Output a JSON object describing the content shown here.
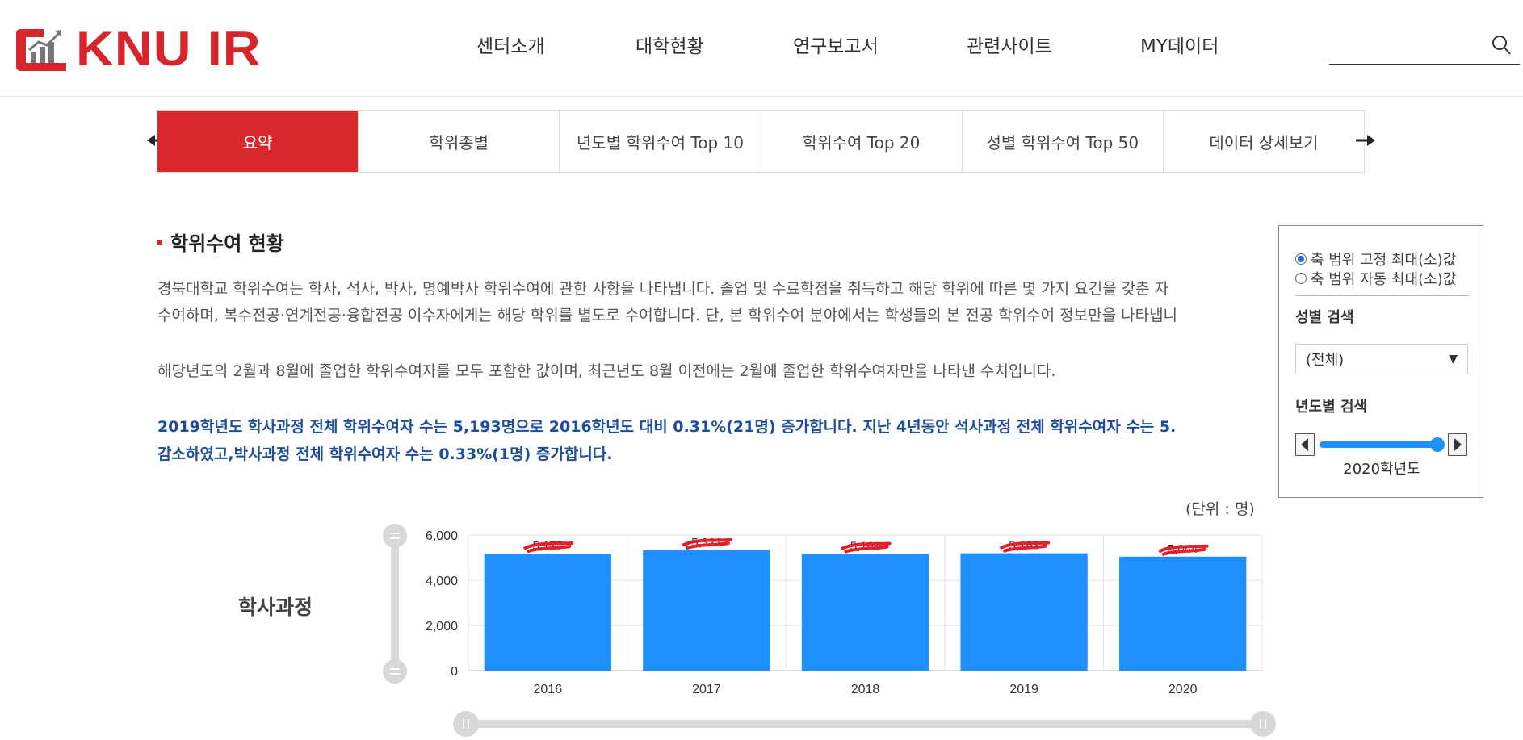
{
  "header": {
    "logo_text": "KNU IR",
    "nav": [
      "센터소개",
      "대학현황",
      "연구보고서",
      "관련사이트",
      "MY데이터"
    ],
    "search_placeholder": ""
  },
  "tabs": [
    {
      "label": "요약",
      "active": true
    },
    {
      "label": "학위종별",
      "active": false
    },
    {
      "label": "년도별 학위수여 Top 10",
      "active": false
    },
    {
      "label": "학위수여 Top 20",
      "active": false
    },
    {
      "label": "성별 학위수여 Top 50",
      "active": false
    },
    {
      "label": "데이터 상세보기",
      "active": false
    }
  ],
  "section": {
    "title": "학위수여 현황",
    "para1_line1": "경북대학교 학위수여는 학사, 석사, 박사, 명예박사 학위수여에 관한 사항을 나타냅니다. 졸업 및 수료학점을 취득하고 해당 학위에 따른 몇 가지 요건을 갖춘 자",
    "para1_line2": "수여하며, 복수전공·연계전공·융합전공 이수자에게는 해당 학위를 별도로 수여합니다. 단, 본 학위수여 분야에서는 학생들의 본 전공 학위수여 정보만을 나타냅니",
    "para2": "해당년도의 2월과 8월에 졸업한 학위수여자를 모두 포함한 값이며, 최근년도 8월 이전에는 2월에 졸업한 학위수여자만을 나타낸 수치입니다.",
    "summary_line1": "2019학년도 학사과정 전체 학위수여자 수는 5,193명으로 2016학년도 대비 0.31%(21명) 증가합니다. 지난 4년동안 석사과정 전체 학위수여자 수는 5.",
    "summary_line2": "감소하였고,박사과정 전체 학위수여자 수는 0.33%(1명) 증가합니다.",
    "unit": "(단위 : 명)",
    "row_label": "학사과정"
  },
  "panel": {
    "radio1": "축 범위 고정 최대(소)값",
    "radio2": "축 범위 자동 최대(소)값",
    "radio_selected": 1,
    "gender_heading": "성별 검색",
    "gender_value": "(전체)",
    "year_heading": "년도별 검색",
    "year_value": "2020학년도"
  },
  "colors": {
    "brand_red": "#d9282c",
    "bar_blue": "#1e90ff",
    "summary_blue": "#1e4d9a",
    "redaction": "#e0202a"
  },
  "chart_data": {
    "type": "bar",
    "categories": [
      "2016",
      "2017",
      "2018",
      "2019",
      "2020"
    ],
    "values": [
      5177,
      5321,
      5161,
      5193,
      5044
    ],
    "data_labels": [
      "5,177",
      "5,321",
      "5,161",
      "5,193",
      "5,044"
    ],
    "yticks": [
      "0",
      "2,000",
      "4,000",
      "6,000"
    ],
    "ylim": [
      0,
      6000
    ],
    "grid": true
  }
}
